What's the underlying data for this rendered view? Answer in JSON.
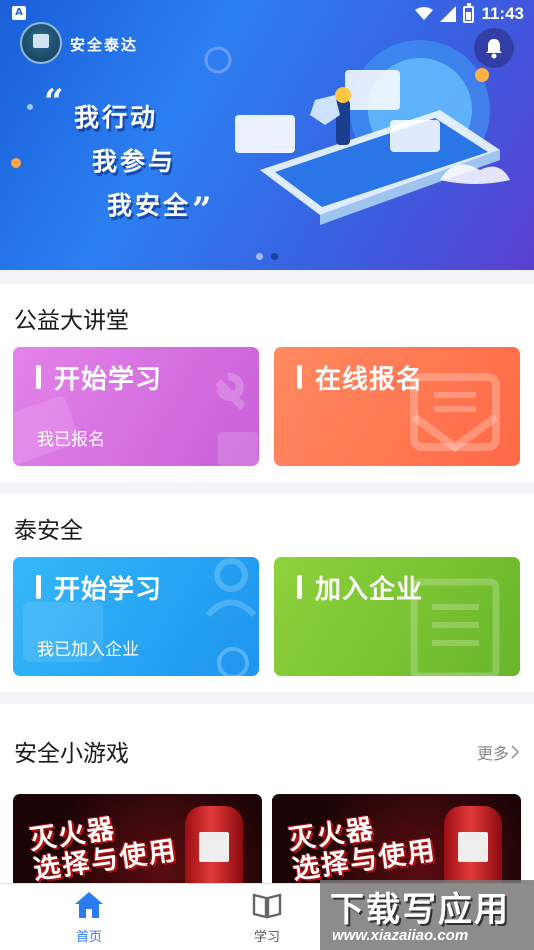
{
  "status_bar": {
    "app_indicator": "A",
    "time": "11:43"
  },
  "banner": {
    "logo_caption": "安全泰达",
    "slogan_lines": [
      "我行动",
      "我参与",
      "我安全"
    ],
    "open_quote": "“",
    "close_quote": "”",
    "carousel_total": 2,
    "carousel_active": 2
  },
  "sections": [
    {
      "title": "公益大讲堂",
      "cards": [
        {
          "title": "开始学习",
          "subtitle": "我已报名",
          "color_from": "#e07ee6",
          "color_to": "#c65ad6"
        },
        {
          "title": "在线报名",
          "subtitle": "",
          "color_from": "#ff8a5a",
          "color_to": "#ff6a45"
        }
      ]
    },
    {
      "title": "泰安全",
      "cards": [
        {
          "title": "开始学习",
          "subtitle": "我已加入企业",
          "color_from": "#32b4f7",
          "color_to": "#1d97f0"
        },
        {
          "title": "加入企业",
          "subtitle": "",
          "color_from": "#8fd03a",
          "color_to": "#6cb82a"
        }
      ]
    }
  ],
  "games": {
    "title": "安全小游戏",
    "more_label": "更多",
    "items": [
      {
        "title_lines": [
          "灭火器",
          "选择与使用"
        ]
      },
      {
        "title_lines": [
          "灭火器",
          "选择与使用"
        ]
      }
    ]
  },
  "tabbar": {
    "active_color": "#2a7df0",
    "tabs": [
      {
        "label": "首页",
        "icon": "home-icon"
      },
      {
        "label": "学习",
        "icon": "book-icon"
      }
    ]
  },
  "watermark": {
    "text": "下载写应用",
    "url": "www.xiazaiiao.com"
  }
}
